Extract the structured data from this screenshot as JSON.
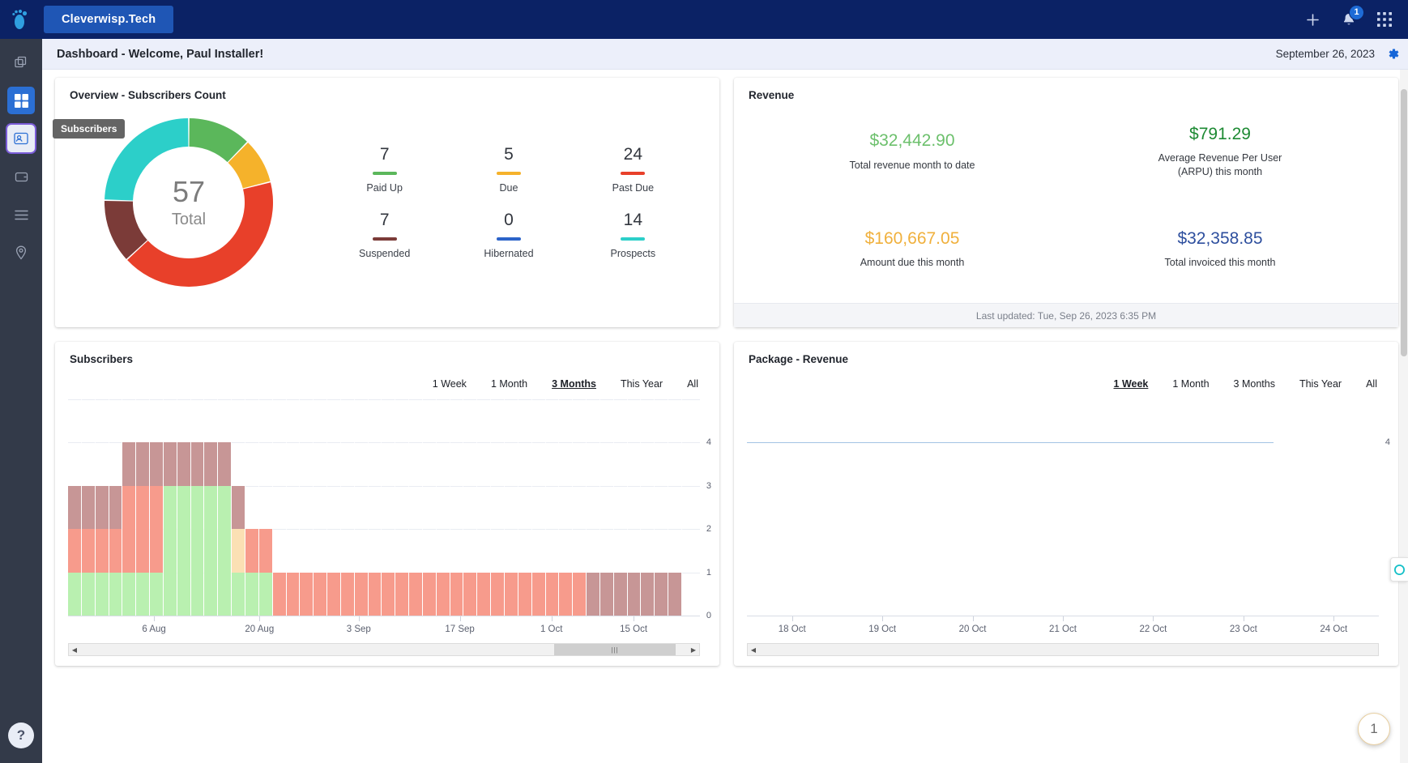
{
  "topbar": {
    "brand": "Cleverwisp.Tech",
    "logo_icon": "footprint-logo-icon",
    "add_icon": "plus-icon",
    "notifications_icon": "bell-icon",
    "notification_count": "1",
    "apps_icon": "grid-apps-icon"
  },
  "sidebar": {
    "items": [
      {
        "name": "sidebar-item-copy",
        "icon": "copy-stack-icon",
        "state": "default"
      },
      {
        "name": "sidebar-item-dashboard",
        "icon": "dashboard-grid-icon",
        "state": "active-blue"
      },
      {
        "name": "sidebar-item-subscribers",
        "icon": "person-card-icon",
        "state": "active-ring"
      },
      {
        "name": "sidebar-item-billing",
        "icon": "wallet-icon",
        "state": "default"
      },
      {
        "name": "sidebar-item-list",
        "icon": "list-icon",
        "state": "default"
      },
      {
        "name": "sidebar-item-map",
        "icon": "map-pin-icon",
        "state": "default"
      }
    ],
    "help_label": "?"
  },
  "page_header": {
    "title": "Dashboard - Welcome, Paul Installer!",
    "date": "September 26, 2023",
    "settings_icon": "gear-icon"
  },
  "overview": {
    "title": "Overview - Subscribers Count",
    "tooltip": "Subscribers",
    "total": "57",
    "total_label": "Total",
    "stats": [
      {
        "value": "7",
        "label": "Paid Up",
        "color": "#5bb75b"
      },
      {
        "value": "5",
        "label": "Due",
        "color": "#f5b22b"
      },
      {
        "value": "24",
        "label": "Past Due",
        "color": "#e8402a"
      },
      {
        "value": "7",
        "label": "Suspended",
        "color": "#7b3b38"
      },
      {
        "value": "0",
        "label": "Hibernated",
        "color": "#2c63c9"
      },
      {
        "value": "14",
        "label": "Prospects",
        "color": "#2ccfc9"
      }
    ],
    "chart_data": {
      "type": "pie",
      "title": "Overview - Subscribers Count",
      "categories": [
        "Paid Up",
        "Due",
        "Past Due",
        "Suspended",
        "Hibernated",
        "Prospects"
      ],
      "values": [
        7,
        5,
        24,
        7,
        0,
        14
      ],
      "colors": [
        "#5bb75b",
        "#f5b22b",
        "#e8402a",
        "#7b3b38",
        "#2c63c9",
        "#2ccfc9"
      ],
      "total": 57,
      "legend": "right"
    }
  },
  "revenue": {
    "title": "Revenue",
    "cells": [
      {
        "value": "$32,442.90",
        "label": "Total revenue month to date",
        "color": "#6cc06c"
      },
      {
        "value": "$791.29",
        "label": "Average Revenue Per User\n(ARPU) this month",
        "color": "#1d8a33"
      },
      {
        "value": "$160,667.05",
        "label": "Amount due this month",
        "color": "#f0b03c"
      },
      {
        "value": "$32,358.85",
        "label": "Total invoiced this month",
        "color": "#2e4f9e"
      }
    ],
    "footer": "Last updated: Tue, Sep 26, 2023 6:35 PM"
  },
  "subscribers_chart": {
    "title": "Subscribers",
    "tabs": [
      {
        "label": "1 Week",
        "active": false
      },
      {
        "label": "1 Month",
        "active": false
      },
      {
        "label": "3 Months",
        "active": true
      },
      {
        "label": "This Year",
        "active": false
      },
      {
        "label": "All",
        "active": false
      }
    ],
    "scroll_thumb_icon": "scroll-grip-icon",
    "scroll_left_icon": "arrow-left-icon",
    "scroll_right_icon": "arrow-right-icon",
    "chart_data": {
      "type": "bar",
      "stacked": true,
      "title": "Subscribers",
      "xlabel": "",
      "ylabel": "",
      "ylim": [
        0,
        5
      ],
      "yticks": [
        0,
        1,
        2,
        3,
        4
      ],
      "grid": true,
      "xtick_labels": [
        "6 Aug",
        "20 Aug",
        "3 Sep",
        "17 Sep",
        "1 Oct",
        "15 Oct"
      ],
      "xtick_positions_pct": [
        13.6,
        30.3,
        46.0,
        62.0,
        76.5,
        89.5
      ],
      "series": [
        {
          "name": "Paid Up",
          "color": "#b9f0b0"
        },
        {
          "name": "Past Due",
          "color": "#f79b8c"
        },
        {
          "name": "Due",
          "color": "#fbe0b4"
        },
        {
          "name": "Suspended",
          "color": "#c79696"
        }
      ],
      "columns": [
        {
          "paid_up": 1,
          "past_due": 1,
          "due": 0,
          "suspended": 1
        },
        {
          "paid_up": 1,
          "past_due": 1,
          "due": 0,
          "suspended": 1
        },
        {
          "paid_up": 1,
          "past_due": 1,
          "due": 0,
          "suspended": 1
        },
        {
          "paid_up": 1,
          "past_due": 1,
          "due": 0,
          "suspended": 1
        },
        {
          "paid_up": 1,
          "past_due": 2,
          "due": 0,
          "suspended": 1
        },
        {
          "paid_up": 1,
          "past_due": 2,
          "due": 0,
          "suspended": 1
        },
        {
          "paid_up": 1,
          "past_due": 2,
          "due": 0,
          "suspended": 1
        },
        {
          "paid_up": 3,
          "past_due": 0,
          "due": 0,
          "suspended": 1
        },
        {
          "paid_up": 3,
          "past_due": 0,
          "due": 0,
          "suspended": 1
        },
        {
          "paid_up": 3,
          "past_due": 0,
          "due": 0,
          "suspended": 1
        },
        {
          "paid_up": 3,
          "past_due": 0,
          "due": 0,
          "suspended": 1
        },
        {
          "paid_up": 3,
          "past_due": 0,
          "due": 0,
          "suspended": 1
        },
        {
          "paid_up": 1,
          "past_due": 0,
          "due": 1,
          "suspended": 1
        },
        {
          "paid_up": 1,
          "past_due": 1,
          "due": 0,
          "suspended": 0
        },
        {
          "paid_up": 1,
          "past_due": 1,
          "due": 0,
          "suspended": 0
        },
        {
          "paid_up": 0,
          "past_due": 1,
          "due": 0,
          "suspended": 0
        },
        {
          "paid_up": 0,
          "past_due": 1,
          "due": 0,
          "suspended": 0
        },
        {
          "paid_up": 0,
          "past_due": 1,
          "due": 0,
          "suspended": 0
        },
        {
          "paid_up": 0,
          "past_due": 1,
          "due": 0,
          "suspended": 0
        },
        {
          "paid_up": 0,
          "past_due": 1,
          "due": 0,
          "suspended": 0
        },
        {
          "paid_up": 0,
          "past_due": 1,
          "due": 0,
          "suspended": 0
        },
        {
          "paid_up": 0,
          "past_due": 1,
          "due": 0,
          "suspended": 0
        },
        {
          "paid_up": 0,
          "past_due": 1,
          "due": 0,
          "suspended": 0
        },
        {
          "paid_up": 0,
          "past_due": 1,
          "due": 0,
          "suspended": 0
        },
        {
          "paid_up": 0,
          "past_due": 1,
          "due": 0,
          "suspended": 0
        },
        {
          "paid_up": 0,
          "past_due": 1,
          "due": 0,
          "suspended": 0
        },
        {
          "paid_up": 0,
          "past_due": 1,
          "due": 0,
          "suspended": 0
        },
        {
          "paid_up": 0,
          "past_due": 1,
          "due": 0,
          "suspended": 0
        },
        {
          "paid_up": 0,
          "past_due": 1,
          "due": 0,
          "suspended": 0
        },
        {
          "paid_up": 0,
          "past_due": 1,
          "due": 0,
          "suspended": 0
        },
        {
          "paid_up": 0,
          "past_due": 1,
          "due": 0,
          "suspended": 0
        },
        {
          "paid_up": 0,
          "past_due": 1,
          "due": 0,
          "suspended": 0
        },
        {
          "paid_up": 0,
          "past_due": 1,
          "due": 0,
          "suspended": 0
        },
        {
          "paid_up": 0,
          "past_due": 1,
          "due": 0,
          "suspended": 0
        },
        {
          "paid_up": 0,
          "past_due": 1,
          "due": 0,
          "suspended": 0
        },
        {
          "paid_up": 0,
          "past_due": 1,
          "due": 0,
          "suspended": 0
        },
        {
          "paid_up": 0,
          "past_due": 1,
          "due": 0,
          "suspended": 0
        },
        {
          "paid_up": 0,
          "past_due": 1,
          "due": 0,
          "suspended": 0
        },
        {
          "paid_up": 0,
          "past_due": 0,
          "due": 0,
          "suspended": 1
        },
        {
          "paid_up": 0,
          "past_due": 0,
          "due": 0,
          "suspended": 1
        },
        {
          "paid_up": 0,
          "past_due": 0,
          "due": 0,
          "suspended": 1
        },
        {
          "paid_up": 0,
          "past_due": 0,
          "due": 0,
          "suspended": 1
        },
        {
          "paid_up": 0,
          "past_due": 0,
          "due": 0,
          "suspended": 1
        },
        {
          "paid_up": 0,
          "past_due": 0,
          "due": 0,
          "suspended": 1
        },
        {
          "paid_up": 0,
          "past_due": 0,
          "due": 0,
          "suspended": 1
        }
      ]
    }
  },
  "package_revenue_chart": {
    "title": "Package - Revenue",
    "tabs": [
      {
        "label": "1 Week",
        "active": true
      },
      {
        "label": "1 Month",
        "active": false
      },
      {
        "label": "3 Months",
        "active": false
      },
      {
        "label": "This Year",
        "active": false
      },
      {
        "label": "All",
        "active": false
      }
    ],
    "scroll_left_icon": "arrow-left-icon",
    "chart_data": {
      "type": "line",
      "title": "Package - Revenue",
      "xlabel": "",
      "ylabel": "",
      "ylim": [
        0,
        5
      ],
      "yticks": [
        4
      ],
      "grid": false,
      "line_color": "#6d9fd4",
      "xtick_labels": [
        "18 Oct",
        "19 Oct",
        "20 Oct",
        "21 Oct",
        "22 Oct",
        "23 Oct",
        "24 Oct"
      ],
      "x": [
        "18 Oct",
        "19 Oct",
        "20 Oct",
        "21 Oct",
        "22 Oct",
        "23 Oct",
        "24 Oct"
      ],
      "values": [
        4,
        4,
        4,
        4,
        4,
        4,
        null
      ]
    }
  },
  "widgets": {
    "chat_icon": "chat-bubble-icon",
    "fab_label": "1"
  }
}
